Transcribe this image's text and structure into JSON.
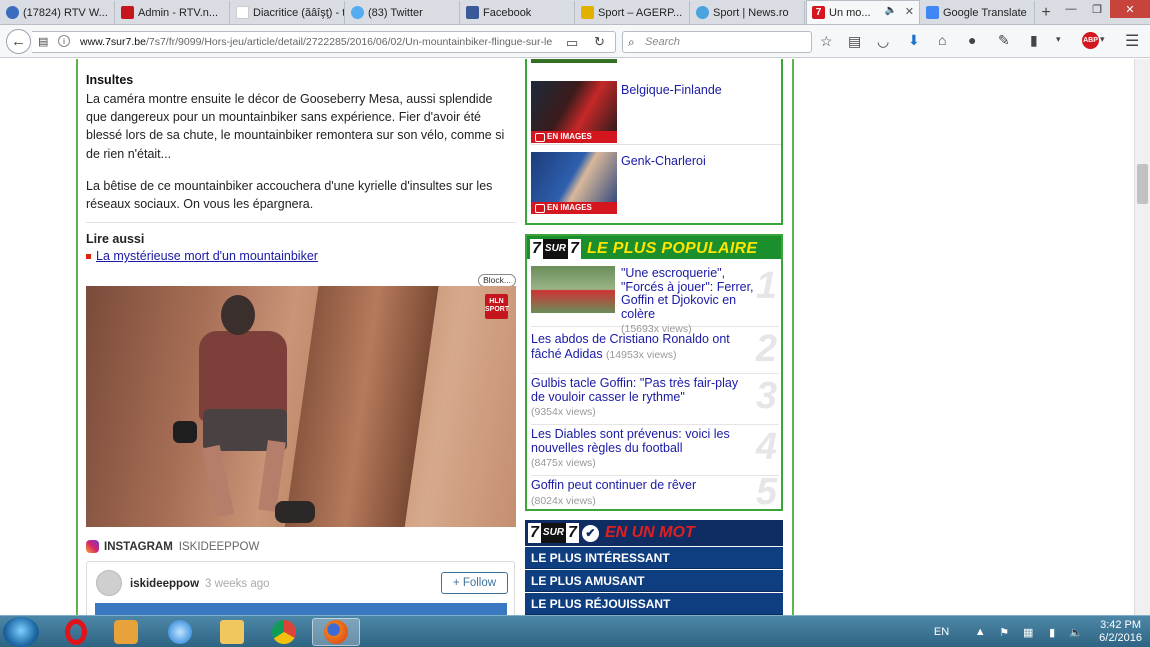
{
  "browser": {
    "tabs": [
      {
        "label": "(17824) RTV W...",
        "fav_color": "#3a6cc0"
      },
      {
        "label": "Admin - RTV.n...",
        "fav_color": "#c4161c"
      },
      {
        "label": "Diacritice (ăâîşţ) - t...",
        "fav_color": "#ffffff"
      },
      {
        "label": "(83) Twitter",
        "fav_color": "#55acee"
      },
      {
        "label": "Facebook",
        "fav_color": "#3b5998"
      },
      {
        "label": "Sport – AGERP...",
        "fav_color": "#e2b100"
      },
      {
        "label": "Sport | News.ro",
        "fav_color": "#4aa3df"
      },
      {
        "label": "Un mo...",
        "fav_color": "#d4171e",
        "active": true
      },
      {
        "label": "Google Translate",
        "fav_color": "#4285f4"
      }
    ],
    "url_host": "www.7sur7.be",
    "url_path": "/7s7/fr/9099/Hors-jeu/article/detail/2722285/2016/06/02/Un-mountainbiker-flingue-sur-le",
    "search_placeholder": "Search"
  },
  "article": {
    "insultes_heading": "Insultes",
    "para1": "La caméra montre ensuite le décor de Gooseberry Mesa, aussi splendide que dangereux pour un mountainbiker sans expérience. Fier d'avoir été blessé lors de sa chute, le mountainbiker remontera sur son vélo, comme si de rien n'était...",
    "para2": "La bêtise de ce mountainbiker accouchera d'une kyrielle d'insultes sur les réseaux sociaux. On vous les épargnera.",
    "lire_aussi": "Lire aussi",
    "lire_link": "La mystérieuse mort d'un mountainbiker",
    "block_label": "Block...",
    "video_badge": "HLN SPORT",
    "instagram_label": "INSTAGRAM",
    "instagram_user": "ISKIDEEPPOW",
    "card_user": "iskideeppow",
    "card_ago": "3 weeks ago",
    "follow_label": "+ Follow"
  },
  "sidebar": {
    "image_items": [
      {
        "title": "Belgique-Finlande",
        "caption": "EN IMAGES"
      },
      {
        "title": "Genk-Charleroi",
        "caption": "EN IMAGES"
      }
    ],
    "brand_7": "7",
    "brand_sur": "SUR",
    "brand_7b": "7",
    "popular_title": "LE PLUS POPULAIRE",
    "popular": [
      {
        "title": "\"Une escroquerie\", \"Forcés à jouer\": Ferrer, Goffin et Djokovic en colère",
        "views": "(15693x views)",
        "num": "1"
      },
      {
        "title": "Les abdos de Cristiano Ronaldo ont fâché Adidas",
        "views": "(14953x views)",
        "num": "2"
      },
      {
        "title": "Gulbis tacle Goffin: \"Pas très fair-play de vouloir casser le rythme\"",
        "views": "(9354x views)",
        "num": "3"
      },
      {
        "title": "Les Diables sont prévenus: voici les nouvelles règles du football",
        "views": "(8475x views)",
        "num": "4"
      },
      {
        "title": "Goffin peut continuer de rêver",
        "views": "(8024x views)",
        "num": "5"
      }
    ],
    "mot_title": "EN UN MOT",
    "mot_items": [
      "LE PLUS INTÉRESSANT",
      "LE PLUS AMUSANT",
      "LE PLUS RÉJOUISSANT"
    ]
  },
  "taskbar": {
    "lang": "EN",
    "time": "3:42 PM",
    "date": "6/2/2016"
  }
}
